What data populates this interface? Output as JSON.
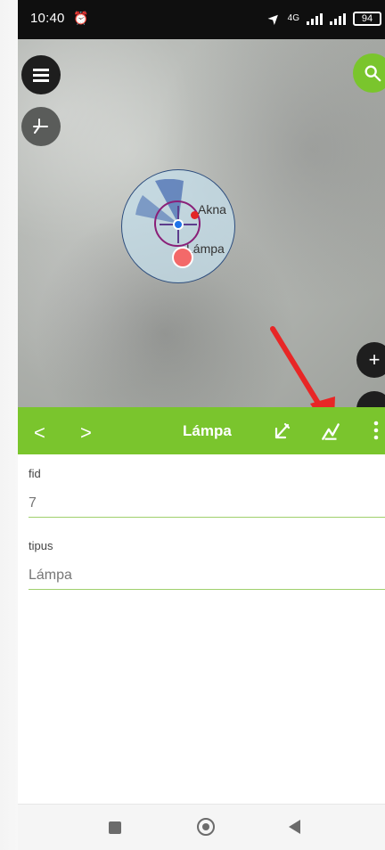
{
  "status_bar": {
    "time": "10:40",
    "alarm_icon": "alarm-clock-icon",
    "network_type": "4G",
    "battery": "94"
  },
  "map": {
    "labels": {
      "akna": "Akna",
      "lampa": "Lámpa"
    },
    "buttons": {
      "menu_icon": "menu-icon",
      "digitize_icon": "digitize-icon",
      "search_icon": "search-icon",
      "zoom_in": "+"
    }
  },
  "toolbar": {
    "previous": "<",
    "next": ">",
    "title": "Lámpa",
    "edit_icon": "edit-geometry-icon",
    "reshape_icon": "reshape-geometry-icon",
    "more_icon": "more-options-icon"
  },
  "form": {
    "fields": [
      {
        "label": "fid",
        "value": "7"
      },
      {
        "label": "tipus",
        "value": "Lámpa"
      }
    ]
  },
  "navigation": {
    "recent_icon": "recent-apps-icon",
    "home_icon": "home-icon",
    "back_icon": "back-icon"
  },
  "colors": {
    "accent_green": "#7ac52d",
    "annotation_red": "#e82626",
    "map_blue": "#c4ddea",
    "map_purple": "#8a1f78"
  }
}
